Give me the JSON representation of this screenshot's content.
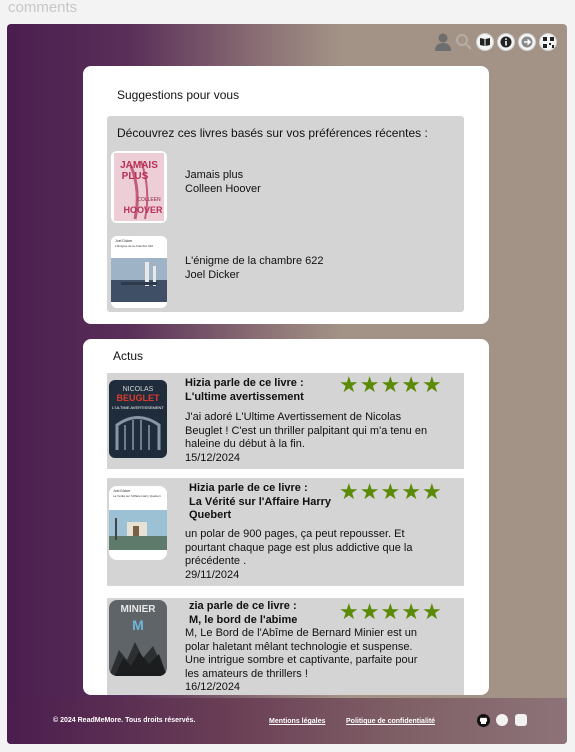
{
  "top_label": "comments",
  "suggestions": {
    "title": "Suggestions pour vous",
    "subtitle": "Découvrez ces livres basés sur vos préférences récentes :",
    "books": [
      {
        "title": "Jamais plus",
        "author": "Colleen Hoover",
        "cover_text_1": "JAMAIS",
        "cover_text_2": "PLUS",
        "cover_text_3": "COLLEEN",
        "cover_text_4": "HOOVER"
      },
      {
        "title": "L'énigme de la chambre 622",
        "author": "Joel Dicker",
        "cover_text_1": "Joel Dicker",
        "cover_text_2": "L'Énigme de la chambre 622"
      }
    ]
  },
  "actus": {
    "title": "Actus",
    "posts": [
      {
        "header": "Hizia parle de ce livre :",
        "book": "L'ultime avertissement",
        "body_1": "J'ai adoré L'Ultime Avertissement de Nicolas",
        "body_2": "Beuglet ! C'est un thriller palpitant qui m'a tenu en",
        "body_3": "haleine du début à la fin.",
        "date": "15/12/2024",
        "rating": 5,
        "cover_text_1": "NICOLAS",
        "cover_text_2": "BEUGLET",
        "cover_text_3": "L'ULTIME AVERTISSEMENT"
      },
      {
        "header": "Hizia parle de ce livre :",
        "book_1": "La Vérité sur l'Affaire Harry",
        "book_2": "Quebert",
        "body_1": "un polar de 900 pages, ça peut repousser. Et",
        "body_2": "pourtant chaque page est plus addictive que la",
        "body_3": "précédente .",
        "date": "29/11/2024",
        "rating": 5,
        "cover_text_1": "Joel Dicker",
        "cover_text_2": "La Vérité sur l'Affaire Harry Quebert"
      },
      {
        "header": "zia parle de ce livre :",
        "book": "M, le bord de l'abime",
        "body_1": "M, Le Bord de l'Abîme de Bernard Minier est un",
        "body_2": "polar haletant mêlant technologie et suspense.",
        "body_3": "Une intrigue sombre et captivante, parfaite pour",
        "body_4": "les amateurs de thrillers !",
        "date": "16/12/2024",
        "rating": 5,
        "cover_text_1": "MINIER",
        "cover_text_2": "M"
      }
    ]
  },
  "footer": {
    "copyright": "© 2024 ReadMeMore. Tous droits réservés.",
    "legal": "Mentions légales",
    "privacy": "Politique de confidentialité"
  },
  "star_char": "★",
  "colors": {
    "star": "#5b8a07",
    "panel": "#d4d4d4",
    "card": "#ffffff"
  },
  "icons": [
    "user-icon",
    "search-icon",
    "book-icon",
    "info-icon",
    "arrow-right-icon",
    "qr-code-icon",
    "github-icon"
  ]
}
